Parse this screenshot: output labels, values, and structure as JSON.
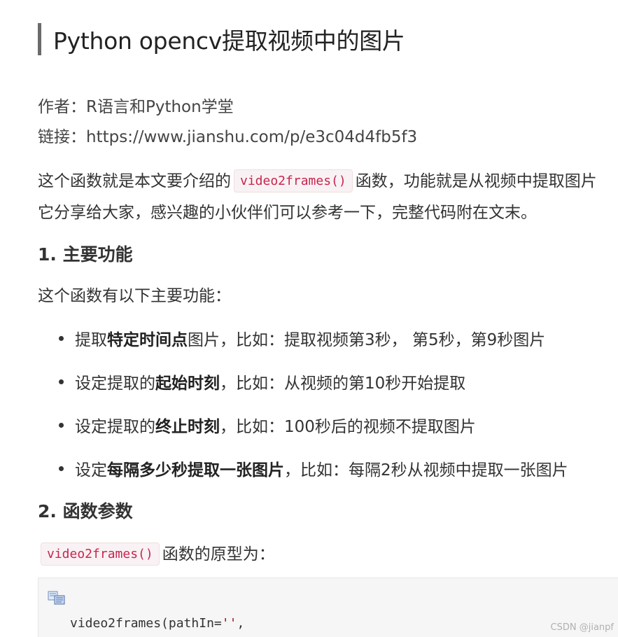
{
  "article": {
    "title": "Python opencv提取视频中的图片",
    "author_label": "作者：",
    "author_value": "R语言和Python学堂",
    "link_label": "链接：",
    "link_value": "https://www.jianshu.com/p/e3c04d4fb5f3",
    "intro": {
      "before": "这个函数就是本文要介绍的",
      "code": "video2frames()",
      "after": "函数，功能就是从视频中提取图片",
      "line2": "它分享给大家，感兴趣的小伙伴们可以参考一下，完整代码附在文末。"
    },
    "section1": {
      "heading": "1. 主要功能",
      "lead": "这个函数有以下主要功能：",
      "items": [
        {
          "pre": "提取",
          "bold": "特定时间点",
          "post": "图片，比如：提取视频第3秒， 第5秒，第9秒图片"
        },
        {
          "pre": "设定提取的",
          "bold": "起始时刻",
          "post": "，比如：从视频的第10秒开始提取"
        },
        {
          "pre": "设定提取的",
          "bold": "终止时刻",
          "post": "，比如：100秒后的视频不提取图片"
        },
        {
          "pre": "设定",
          "bold": "每隔多少秒提取一张图片",
          "post": "，比如：每隔2秒从视频中提取一张图片"
        }
      ]
    },
    "section2": {
      "heading": "2. 函数参数",
      "code": "video2frames()",
      "lead_after": "函数的原型为："
    },
    "code_block": {
      "fn": "video2frames(pathIn=",
      "str": "''",
      "rest": ","
    }
  },
  "watermark": "CSDN @jianpf",
  "colors": {
    "accent_bar": "#6b6b6b",
    "inline_code_text": "#c7254e",
    "inline_code_bg": "#f9f2f4",
    "code_block_bg": "#f6f6f6"
  },
  "icons": {
    "copy": "copy-icon"
  }
}
